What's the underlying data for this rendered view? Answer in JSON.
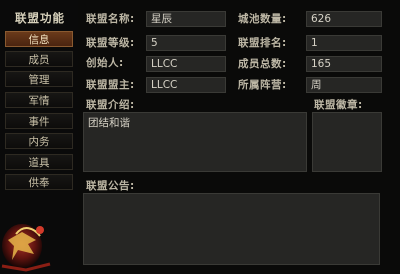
{
  "sidebar": {
    "title": "联盟功能",
    "items": [
      {
        "label": "信息",
        "active": true
      },
      {
        "label": "成员",
        "active": false
      },
      {
        "label": "管理",
        "active": false
      },
      {
        "label": "军情",
        "active": false
      },
      {
        "label": "事件",
        "active": false
      },
      {
        "label": "内务",
        "active": false
      },
      {
        "label": "道具",
        "active": false
      },
      {
        "label": "供奉",
        "active": false
      }
    ]
  },
  "info": {
    "name_label": "联盟名称:",
    "name_value": "星辰",
    "cities_label": "城池数量:",
    "cities_value": "626",
    "level_label": "联盟等级:",
    "level_value": "5",
    "rank_label": "联盟排名:",
    "rank_value": "1",
    "founder_label": "创始人:",
    "founder_value": "LLCC",
    "members_label": "成员总数:",
    "members_value": "165",
    "leader_label": "联盟盟主:",
    "leader_value": "LLCC",
    "faction_label": "所属阵营:",
    "faction_value": "周",
    "intro_label": "联盟介绍:",
    "intro_value": "团结和谐",
    "emblem_label": "联盟徽章:",
    "notice_label": "联盟公告:",
    "notice_value": ""
  },
  "colors": {
    "active_tab": "#5a2e14",
    "field_bg": "#262624",
    "label_text": "#bdb7a5"
  }
}
